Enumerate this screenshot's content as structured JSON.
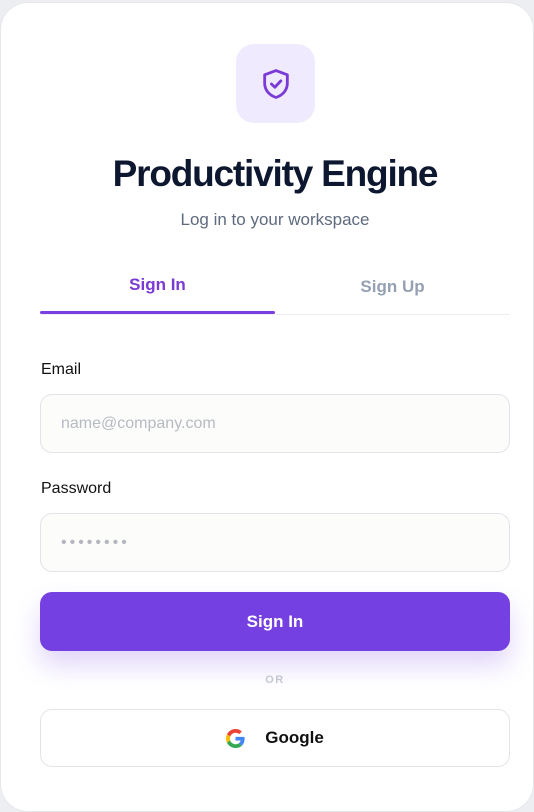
{
  "app": {
    "title": "Productivity Engine",
    "subtitle": "Log in to your workspace",
    "logo_icon": "shield-check-icon"
  },
  "tabs": [
    {
      "label": "Sign In",
      "active": true
    },
    {
      "label": "Sign Up",
      "active": false
    }
  ],
  "form": {
    "email": {
      "label": "Email",
      "placeholder": "name@company.com",
      "value": ""
    },
    "password": {
      "label": "Password",
      "placeholder": "••••••••",
      "value": ""
    },
    "submit_label": "Sign In"
  },
  "divider_text": "OR",
  "social": {
    "google_label": "Google",
    "google_icon": "google-icon"
  },
  "colors": {
    "accent": "#7440e2",
    "accent_text": "#7a3ad6",
    "logo_tile_bg": "#efeafd",
    "title": "#0e1730",
    "muted": "#95a0b3"
  }
}
